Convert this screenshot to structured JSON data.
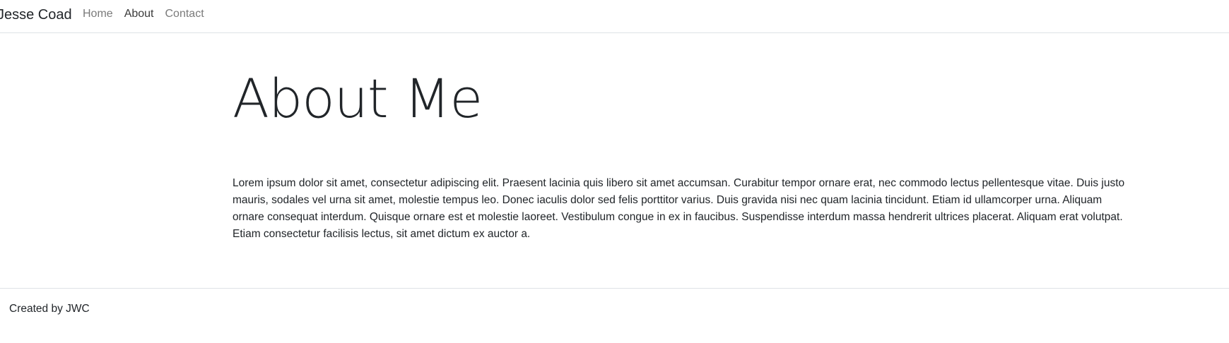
{
  "navbar": {
    "brand": "Jesse Coad",
    "items": [
      {
        "label": "Home",
        "active": false
      },
      {
        "label": "About",
        "active": true
      },
      {
        "label": "Contact",
        "active": false
      }
    ]
  },
  "main": {
    "title": "About Me",
    "paragraph": "Lorem ipsum dolor sit amet, consectetur adipiscing elit. Praesent lacinia quis libero sit amet accumsan. Curabitur tempor ornare erat, nec commodo lectus pellentesque vitae. Duis justo mauris, sodales vel urna sit amet, molestie tempus leo. Donec iaculis dolor sed felis porttitor varius. Duis gravida nisi nec quam lacinia tincidunt. Etiam id ullamcorper urna. Aliquam ornare consequat interdum. Quisque ornare est et molestie laoreet. Vestibulum congue in ex in faucibus. Suspendisse interdum massa hendrerit ultrices placerat. Aliquam erat volutpat. Etiam consectetur facilisis lectus, sit amet dictum ex auctor a."
  },
  "footer": {
    "text": "Created by JWC"
  },
  "colors": {
    "text": "#212529",
    "nav_inactive": "#7a7a7a",
    "nav_active": "#3a3a3a",
    "border": "#dee2e6",
    "background": "#ffffff"
  }
}
